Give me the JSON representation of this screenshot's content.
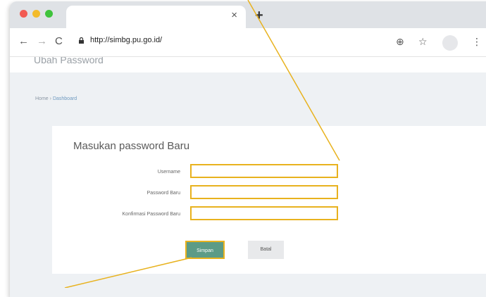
{
  "browser": {
    "tab_close": "×",
    "new_tab": "+",
    "nav": {
      "back": "←",
      "forward": "→",
      "reload": "C"
    },
    "url": "http://simbg.pu.go.id/",
    "icons": {
      "target": "⊕",
      "star": "☆",
      "menu": "⋮"
    }
  },
  "page": {
    "title": "Ubah Password",
    "breadcrumb": {
      "home": "Home",
      "separator": "›",
      "current": "Dashboard"
    }
  },
  "form": {
    "title": "Masukan password Baru",
    "fields": [
      {
        "label": "Username",
        "value": ""
      },
      {
        "label": "Password Baru",
        "value": ""
      },
      {
        "label": "Konfirmasi Password Baru",
        "value": ""
      }
    ],
    "save_label": "Simpan",
    "cancel_label": "Batal"
  },
  "colors": {
    "highlight": "#e8b21e",
    "save_button": "#5c9b86",
    "tabbar": "#dfe2e6",
    "content_bg": "#eef1f4"
  }
}
